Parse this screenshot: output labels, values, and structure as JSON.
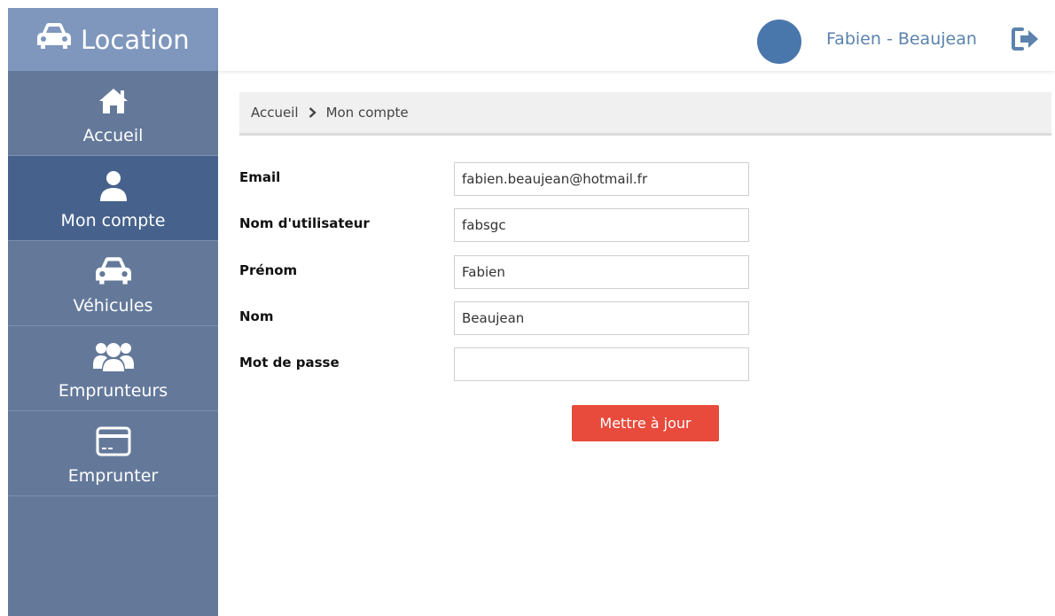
{
  "app": {
    "brand": "Location"
  },
  "sidebar": {
    "items": [
      {
        "label": "Accueil",
        "icon": "home-icon",
        "active": false
      },
      {
        "label": "Mon compte",
        "icon": "user-icon",
        "active": true
      },
      {
        "label": "Véhicules",
        "icon": "car-icon",
        "active": false
      },
      {
        "label": "Emprunteurs",
        "icon": "users-icon",
        "active": false
      },
      {
        "label": "Emprunter",
        "icon": "card-icon",
        "active": false
      }
    ]
  },
  "header": {
    "username": "Fabien - Beaujean",
    "logout_icon": "logout-icon"
  },
  "breadcrumb": {
    "items": [
      "Accueil",
      "Mon compte"
    ]
  },
  "form": {
    "fields": [
      {
        "label": "Email",
        "value": "fabien.beaujean@hotmail.fr"
      },
      {
        "label": "Nom d'utilisateur",
        "value": "fabsgc"
      },
      {
        "label": "Prénom",
        "value": "Fabien"
      },
      {
        "label": "Nom",
        "value": "Beaujean"
      },
      {
        "label": "Mot de passe",
        "value": ""
      }
    ],
    "submit_label": "Mettre à jour"
  },
  "colors": {
    "sidebar": "#64799a",
    "sidebar_active": "#46628c",
    "brand_bg": "#7f97bd",
    "accent_button": "#e84a3c",
    "username": "#5b83ad"
  }
}
